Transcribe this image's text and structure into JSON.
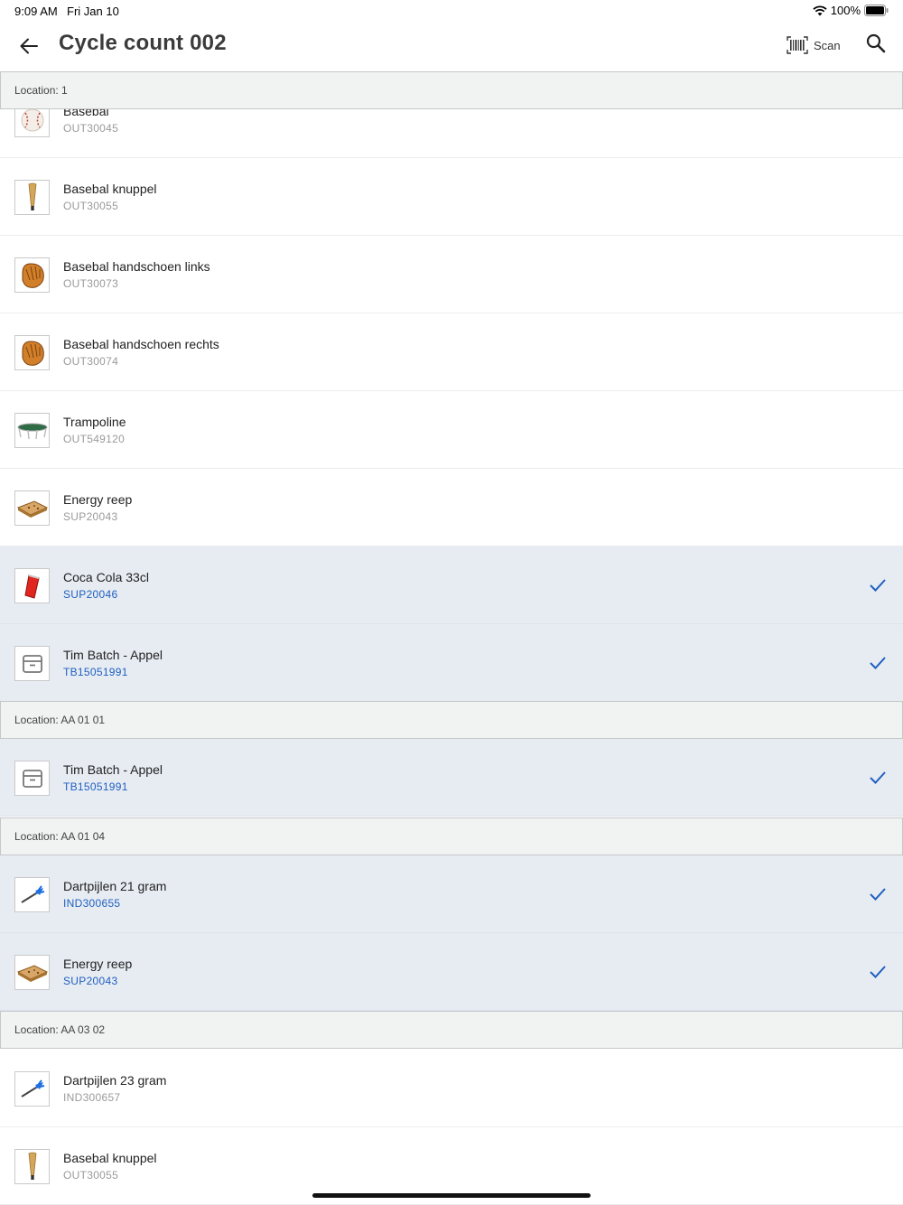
{
  "status_bar": {
    "time": "9:09 AM",
    "date": "Fri Jan 10",
    "battery": "100%"
  },
  "header": {
    "title": "Cycle count 002",
    "scan_label": "Scan"
  },
  "colors": {
    "checked_row_bg": "#e7ecf3",
    "check_accent": "#1f5fbf",
    "location_bg": "#f1f2f2"
  },
  "locations": [
    {
      "label": "Location: 1"
    },
    {
      "label": "Location: AA 01 01"
    },
    {
      "label": "Location: AA 01 04"
    },
    {
      "label": "Location: AA 03 02"
    }
  ],
  "items": [
    {
      "name": "Basebal",
      "code": "OUT30045",
      "icon": "baseball-icon",
      "checked": false
    },
    {
      "name": "Basebal knuppel",
      "code": "OUT30055",
      "icon": "baseball-bat-icon",
      "checked": false
    },
    {
      "name": "Basebal handschoen links",
      "code": "OUT30073",
      "icon": "baseball-glove-icon",
      "checked": false
    },
    {
      "name": "Basebal handschoen rechts",
      "code": "OUT30074",
      "icon": "baseball-glove-icon",
      "checked": false
    },
    {
      "name": "Trampoline",
      "code": "OUT549120",
      "icon": "trampoline-icon",
      "checked": false
    },
    {
      "name": "Energy reep",
      "code": "SUP20043",
      "icon": "energy-bar-icon",
      "checked": false
    },
    {
      "name": "Coca Cola 33cl",
      "code": "SUP20046",
      "icon": "soda-can-icon",
      "checked": true
    },
    {
      "name": "Tim Batch - Appel",
      "code": "TB15051991",
      "icon": "archive-box-icon",
      "checked": true
    },
    {
      "name": "Tim Batch - Appel",
      "code": "TB15051991",
      "icon": "archive-box-icon",
      "checked": true
    },
    {
      "name": "Dartpijlen 21 gram",
      "code": "IND300655",
      "icon": "dart-icon",
      "checked": true
    },
    {
      "name": "Energy reep",
      "code": "SUP20043",
      "icon": "energy-bar-icon",
      "checked": true
    },
    {
      "name": "Dartpijlen 23 gram",
      "code": "IND300657",
      "icon": "dart-icon",
      "checked": false
    },
    {
      "name": "Basebal knuppel",
      "code": "OUT30055",
      "icon": "baseball-bat-icon",
      "checked": false
    }
  ]
}
